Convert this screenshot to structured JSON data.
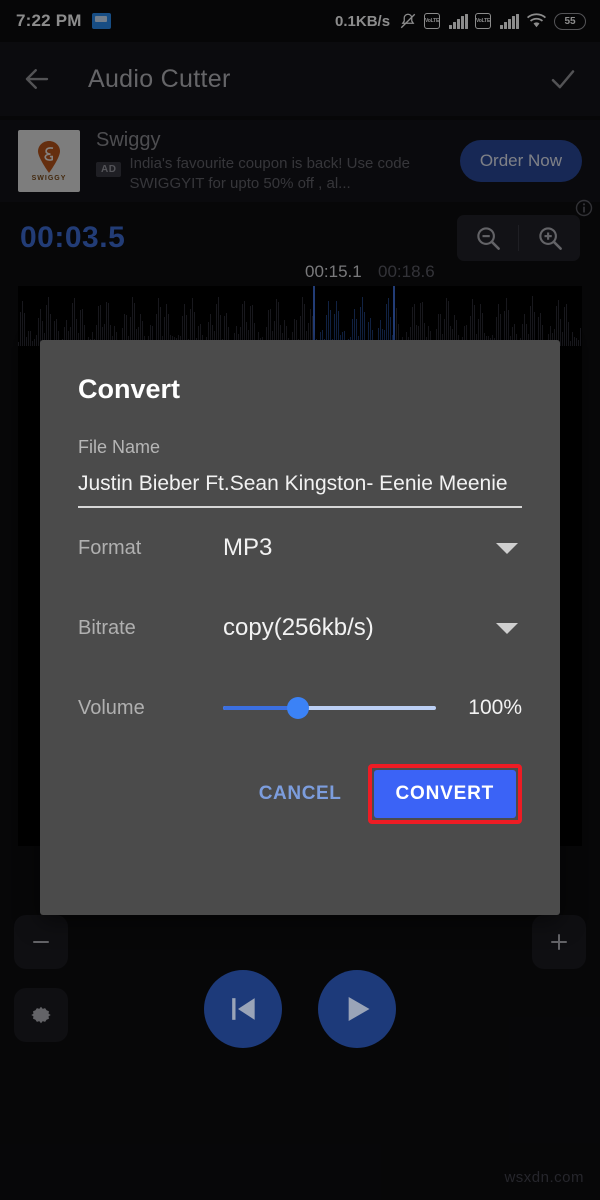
{
  "status_bar": {
    "time": "7:22 PM",
    "app_icon": "folder-icon",
    "network_speed": "0.1KB/s",
    "mute_icon": "bell-muted-icon",
    "sim1_label": "VoLTE",
    "sim2_label": "VoLTE",
    "wifi_icon": "wifi-icon",
    "battery_level": "55"
  },
  "app_bar": {
    "back_icon": "arrow-left-icon",
    "title": "Audio Cutter",
    "confirm_icon": "check-icon"
  },
  "ad": {
    "logo_text": "SWIGGY",
    "advertiser": "Swiggy",
    "badge": "AD",
    "description": "India's favourite coupon is back! Use code SWIGGYIT for upto 50% off , al...",
    "cta_label": "Order Now",
    "info_icon": "ad-choices-info-icon"
  },
  "editor": {
    "current_time": "00:03.5",
    "zoom_out_icon": "magnifier-minus-icon",
    "zoom_in_icon": "magnifier-plus-icon",
    "selection_start": "00:15.1",
    "selection_end": "00:18.6",
    "minus_icon": "minus-icon",
    "settings_icon": "gear-icon",
    "plus_icon": "plus-icon"
  },
  "dialog": {
    "title": "Convert",
    "file_name_label": "File Name",
    "file_name_value": "Justin Bieber Ft.Sean Kingston- Eenie Meenie",
    "format_label": "Format",
    "format_value": "MP3",
    "bitrate_label": "Bitrate",
    "bitrate_value": "copy(256kb/s)",
    "volume_label": "Volume",
    "volume_value": "100%",
    "cancel_label": "CANCEL",
    "convert_label": "CONVERT",
    "accent_color": "#3b63f6",
    "highlight_color": "#ee1c24"
  },
  "transport": {
    "skip_start_icon": "skip-previous-icon",
    "play_icon": "play-icon"
  },
  "watermark": "wsxdn.com"
}
